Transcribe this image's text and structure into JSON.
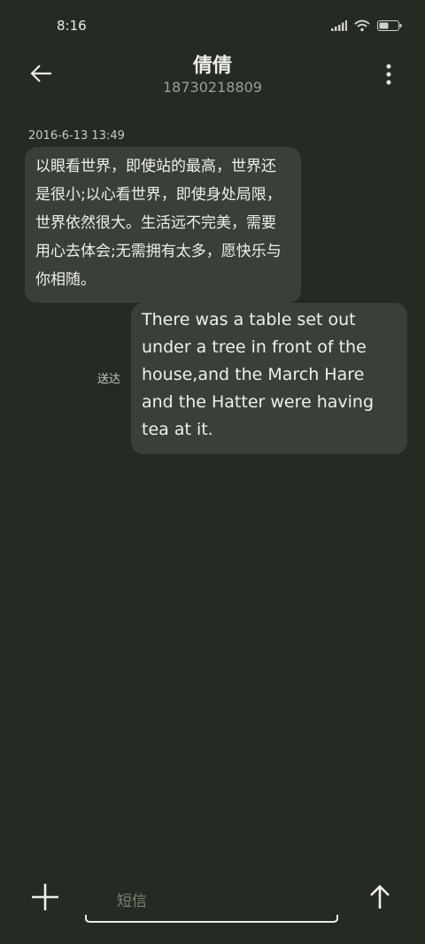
{
  "status_bar": {
    "time": "8:16"
  },
  "header": {
    "contact_name": "倩倩",
    "phone_number": "18730218809"
  },
  "conversation": {
    "timestamp": "2016-6-13 13:49",
    "incoming_message": "以眼看世界，即使站的最高，世界还是很小;以心看世界，即使身处局限，世界依然很大。生活远不完美，需要用心去体会;无需拥有太多，愿快乐与你相随。",
    "outgoing_message": "There was a table set out under a tree in front of the house,and the March Hare and the Hatter were having tea at it.",
    "delivery_status": "送达"
  },
  "composer": {
    "placeholder": "短信"
  },
  "icons": {
    "back": "arrow-left-icon",
    "more": "more-vertical-icon",
    "add": "plus-icon",
    "send": "arrow-up-icon",
    "signal": "signal-icon",
    "wifi": "wifi-icon",
    "battery": "battery-icon"
  }
}
